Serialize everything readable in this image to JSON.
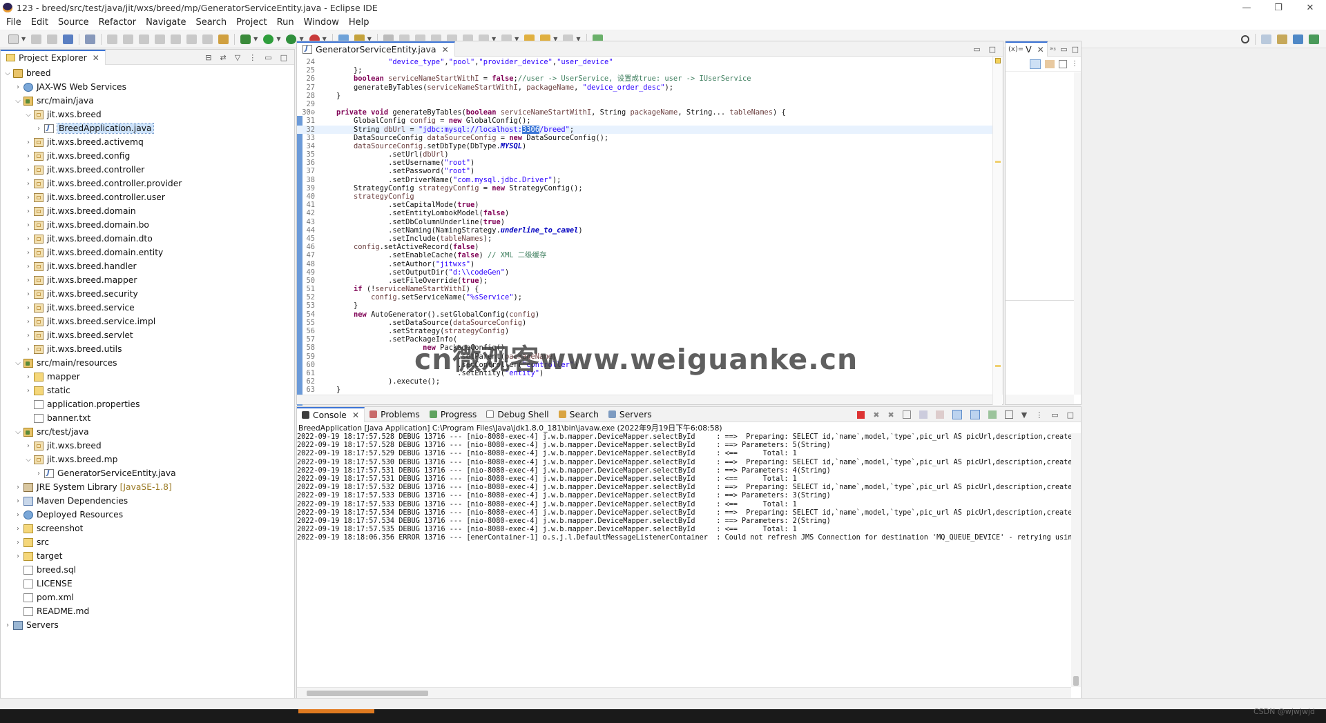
{
  "window": {
    "title": "123 - breed/src/test/java/jit/wxs/breed/mp/GeneratorServiceEntity.java - Eclipse IDE",
    "controls": [
      "—",
      "❐",
      "✕"
    ]
  },
  "menu": [
    "File",
    "Edit",
    "Source",
    "Refactor",
    "Navigate",
    "Search",
    "Project",
    "Run",
    "Window",
    "Help"
  ],
  "project_explorer": {
    "title": "Project Explorer",
    "items": [
      {
        "label": "breed",
        "level": 0,
        "chev": "⌵",
        "icon": "ic-project"
      },
      {
        "label": "JAX-WS Web Services",
        "level": 1,
        "chev": "›",
        "icon": "ic-globe"
      },
      {
        "label": "src/main/java",
        "level": 1,
        "chev": "⌵",
        "icon": "ic-srcfolder"
      },
      {
        "label": "jit.wxs.breed",
        "level": 2,
        "chev": "⌵",
        "icon": "ic-package"
      },
      {
        "label": "BreedApplication.java",
        "level": 3,
        "chev": "›",
        "icon": "ic-java",
        "selected": true
      },
      {
        "label": "jit.wxs.breed.activemq",
        "level": 2,
        "chev": "›",
        "icon": "ic-package"
      },
      {
        "label": "jit.wxs.breed.config",
        "level": 2,
        "chev": "›",
        "icon": "ic-package"
      },
      {
        "label": "jit.wxs.breed.controller",
        "level": 2,
        "chev": "›",
        "icon": "ic-package"
      },
      {
        "label": "jit.wxs.breed.controller.provider",
        "level": 2,
        "chev": "›",
        "icon": "ic-package"
      },
      {
        "label": "jit.wxs.breed.controller.user",
        "level": 2,
        "chev": "›",
        "icon": "ic-package"
      },
      {
        "label": "jit.wxs.breed.domain",
        "level": 2,
        "chev": "›",
        "icon": "ic-package"
      },
      {
        "label": "jit.wxs.breed.domain.bo",
        "level": 2,
        "chev": "›",
        "icon": "ic-package"
      },
      {
        "label": "jit.wxs.breed.domain.dto",
        "level": 2,
        "chev": "›",
        "icon": "ic-package"
      },
      {
        "label": "jit.wxs.breed.domain.entity",
        "level": 2,
        "chev": "›",
        "icon": "ic-package"
      },
      {
        "label": "jit.wxs.breed.handler",
        "level": 2,
        "chev": "›",
        "icon": "ic-package"
      },
      {
        "label": "jit.wxs.breed.mapper",
        "level": 2,
        "chev": "›",
        "icon": "ic-package"
      },
      {
        "label": "jit.wxs.breed.security",
        "level": 2,
        "chev": "›",
        "icon": "ic-package"
      },
      {
        "label": "jit.wxs.breed.service",
        "level": 2,
        "chev": "›",
        "icon": "ic-package"
      },
      {
        "label": "jit.wxs.breed.service.impl",
        "level": 2,
        "chev": "›",
        "icon": "ic-package"
      },
      {
        "label": "jit.wxs.breed.servlet",
        "level": 2,
        "chev": "›",
        "icon": "ic-package"
      },
      {
        "label": "jit.wxs.breed.utils",
        "level": 2,
        "chev": "›",
        "icon": "ic-package"
      },
      {
        "label": "src/main/resources",
        "level": 1,
        "chev": "⌵",
        "icon": "ic-srcfolder"
      },
      {
        "label": "mapper",
        "level": 2,
        "chev": "›",
        "icon": "ic-folder"
      },
      {
        "label": "static",
        "level": 2,
        "chev": "›",
        "icon": "ic-folder"
      },
      {
        "label": "application.properties",
        "level": 2,
        "chev": "",
        "icon": "ic-file"
      },
      {
        "label": "banner.txt",
        "level": 2,
        "chev": "",
        "icon": "ic-file"
      },
      {
        "label": "src/test/java",
        "level": 1,
        "chev": "⌵",
        "icon": "ic-srcfolder"
      },
      {
        "label": "jit.wxs.breed",
        "level": 2,
        "chev": "›",
        "icon": "ic-package"
      },
      {
        "label": "jit.wxs.breed.mp",
        "level": 2,
        "chev": "⌵",
        "icon": "ic-package"
      },
      {
        "label": "GeneratorServiceEntity.java",
        "level": 3,
        "chev": "›",
        "icon": "ic-java"
      },
      {
        "label": "JRE System Library",
        "suffix": "[JavaSE-1.8]",
        "level": 1,
        "chev": "›",
        "icon": "ic-lib"
      },
      {
        "label": "Maven Dependencies",
        "level": 1,
        "chev": "›",
        "icon": "ic-jar"
      },
      {
        "label": "Deployed Resources",
        "level": 1,
        "chev": "›",
        "icon": "ic-globe"
      },
      {
        "label": "screenshot",
        "level": 1,
        "chev": "›",
        "icon": "ic-folder"
      },
      {
        "label": "src",
        "level": 1,
        "chev": "›",
        "icon": "ic-folder"
      },
      {
        "label": "target",
        "level": 1,
        "chev": "›",
        "icon": "ic-folder"
      },
      {
        "label": "breed.sql",
        "level": 1,
        "chev": "",
        "icon": "ic-file"
      },
      {
        "label": "LICENSE",
        "level": 1,
        "chev": "",
        "icon": "ic-file"
      },
      {
        "label": "pom.xml",
        "level": 1,
        "chev": "",
        "icon": "ic-file"
      },
      {
        "label": "README.md",
        "level": 1,
        "chev": "",
        "icon": "ic-file"
      },
      {
        "label": "Servers",
        "level": 0,
        "chev": "›",
        "icon": "ic-server"
      }
    ]
  },
  "editor": {
    "tab_label": "GeneratorServiceEntity.java",
    "current_line": 32,
    "lines": [
      {
        "n": "24",
        "html": "                <span class=\"str\">\"device_type\"</span>,<span class=\"str\">\"pool\"</span>,<span class=\"str\">\"provider_device\"</span>,<span class=\"str\">\"user_device\"</span>"
      },
      {
        "n": "25",
        "html": "        };"
      },
      {
        "n": "26",
        "html": "        <span class=\"kw\">boolean</span> <span class=\"var\">serviceNameStartWithI</span> = <span class=\"kw\">false</span>;<span class=\"cmt\">//user -> UserService, 设置成true: user -> IUserService</span>"
      },
      {
        "n": "27",
        "html": "        generateByTables(<span class=\"var\">serviceNameStartWithI</span>, <span class=\"var\">packageName</span>, <span class=\"str\">\"device_order_desc\"</span>);"
      },
      {
        "n": "28",
        "html": "    }"
      },
      {
        "n": "29",
        "html": ""
      },
      {
        "n": "30⊖",
        "html": "    <span class=\"kw\">private</span> <span class=\"kw\">void</span> generateByTables(<span class=\"kw\">boolean</span> <span class=\"var\">serviceNameStartWithI</span>, String <span class=\"var\">packageName</span>, String... <span class=\"var\">tableNames</span>) {"
      },
      {
        "n": "31",
        "html": "        GlobalConfig <span class=\"var\">config</span> = <span class=\"kw\">new</span> GlobalConfig();"
      },
      {
        "n": "32",
        "html": "        String <span class=\"var\">dbUrl</span> = <span class=\"str\">\"jdbc:mysql://localhost:<span class=\"hl\">3306</span>/breed\"</span>;"
      },
      {
        "n": "33",
        "html": "        DataSourceConfig <span class=\"var\">dataSourceConfig</span> = <span class=\"kw\">new</span> DataSourceConfig();"
      },
      {
        "n": "34",
        "html": "        <span class=\"var\">dataSourceConfig</span>.setDbType(DbType.<span class=\"stf\">MYSQL</span>)"
      },
      {
        "n": "35",
        "html": "                .setUrl(<span class=\"var\">dbUrl</span>)"
      },
      {
        "n": "36",
        "html": "                .setUsername(<span class=\"str\">\"root\"</span>)"
      },
      {
        "n": "37",
        "html": "                .setPassword(<span class=\"str\">\"root\"</span>)"
      },
      {
        "n": "38",
        "html": "                .setDriverName(<span class=\"str\">\"com.mysql.jdbc.Driver\"</span>);"
      },
      {
        "n": "39",
        "html": "        StrategyConfig <span class=\"var\">strategyConfig</span> = <span class=\"kw\">new</span> StrategyConfig();"
      },
      {
        "n": "40",
        "html": "        <span class=\"var\">strategyConfig</span>"
      },
      {
        "n": "41",
        "html": "                .setCapitalMode(<span class=\"kw\">true</span>)"
      },
      {
        "n": "42",
        "html": "                .setEntityLombokModel(<span class=\"kw\">false</span>)"
      },
      {
        "n": "43",
        "html": "                .setDbColumnUnderline(<span class=\"kw\">true</span>)"
      },
      {
        "n": "44",
        "html": "                .setNaming(NamingStrategy.<span class=\"stf\">underline_to_camel</span>)"
      },
      {
        "n": "45",
        "html": "                .setInclude(<span class=\"var\">tableNames</span>);"
      },
      {
        "n": "46",
        "html": "        <span class=\"var\">config</span>.setActiveRecord(<span class=\"kw\">false</span>)"
      },
      {
        "n": "47",
        "html": "                .setEnableCache(<span class=\"kw\">false</span>) <span class=\"cmt\">// XML 二级缓存</span>"
      },
      {
        "n": "48",
        "html": "                .setAuthor(<span class=\"str\">\"jitwxs\"</span>)"
      },
      {
        "n": "49",
        "html": "                .setOutputDir(<span class=\"str\">\"d:\\\\codeGen\"</span>)"
      },
      {
        "n": "50",
        "html": "                .setFileOverride(<span class=\"kw\">true</span>);"
      },
      {
        "n": "51",
        "html": "        <span class=\"kw\">if</span> (!<span class=\"var\">serviceNameStartWithI</span>) {"
      },
      {
        "n": "52",
        "html": "            <span class=\"var\">config</span>.setServiceName(<span class=\"str\">\"%sService\"</span>);"
      },
      {
        "n": "53",
        "html": "        }"
      },
      {
        "n": "54",
        "html": "        <span class=\"kw\">new</span> AutoGenerator().setGlobalConfig(<span class=\"var\">config</span>)"
      },
      {
        "n": "55",
        "html": "                .setDataSource(<span class=\"var\">dataSourceConfig</span>)"
      },
      {
        "n": "56",
        "html": "                .setStrategy(<span class=\"var\">strategyConfig</span>)"
      },
      {
        "n": "57",
        "html": "                .setPackageInfo("
      },
      {
        "n": "58",
        "html": "                        <span class=\"kw\">new</span> PackageConfig()"
      },
      {
        "n": "59",
        "html": "                                .setParent(<span class=\"var\">packageName</span>)"
      },
      {
        "n": "60",
        "html": "                                .setController(<span class=\"str\">\"controller\"</span>)"
      },
      {
        "n": "61",
        "html": "                                .setEntity(<span class=\"str\">\"entity\"</span>)"
      },
      {
        "n": "62",
        "html": "                ).execute();"
      },
      {
        "n": "63",
        "html": "    }"
      },
      {
        "n": "64",
        "html": ""
      }
    ]
  },
  "outline": {
    "tab_label": "V"
  },
  "bottom_panel": {
    "tabs": [
      "Console",
      "Problems",
      "Progress",
      "Debug Shell",
      "Search",
      "Servers"
    ],
    "description": "BreedApplication [Java Application] C:\\Program Files\\Java\\jdk1.8.0_181\\bin\\javaw.exe  (2022年9月19日下午6:08:58)",
    "lines": [
      "2022-09-19 18:17:57.528 DEBUG 13716 --- [nio-8080-exec-4] j.w.b.mapper.DeviceMapper.selectById     : ==>  Preparing: SELECT id,`name`,model,`type`,pic_url AS picUrl,description,create_date AS crea",
      "2022-09-19 18:17:57.528 DEBUG 13716 --- [nio-8080-exec-4] j.w.b.mapper.DeviceMapper.selectById     : ==> Parameters: 5(String)",
      "2022-09-19 18:17:57.529 DEBUG 13716 --- [nio-8080-exec-4] j.w.b.mapper.DeviceMapper.selectById     : <==      Total: 1",
      "2022-09-19 18:17:57.530 DEBUG 13716 --- [nio-8080-exec-4] j.w.b.mapper.DeviceMapper.selectById     : ==>  Preparing: SELECT id,`name`,model,`type`,pic_url AS picUrl,description,create_date AS crea",
      "2022-09-19 18:17:57.531 DEBUG 13716 --- [nio-8080-exec-4] j.w.b.mapper.DeviceMapper.selectById     : ==> Parameters: 4(String)",
      "2022-09-19 18:17:57.531 DEBUG 13716 --- [nio-8080-exec-4] j.w.b.mapper.DeviceMapper.selectById     : <==      Total: 1",
      "2022-09-19 18:17:57.532 DEBUG 13716 --- [nio-8080-exec-4] j.w.b.mapper.DeviceMapper.selectById     : ==>  Preparing: SELECT id,`name`,model,`type`,pic_url AS picUrl,description,create_date AS crea",
      "2022-09-19 18:17:57.533 DEBUG 13716 --- [nio-8080-exec-4] j.w.b.mapper.DeviceMapper.selectById     : ==> Parameters: 3(String)",
      "2022-09-19 18:17:57.533 DEBUG 13716 --- [nio-8080-exec-4] j.w.b.mapper.DeviceMapper.selectById     : <==      Total: 1",
      "2022-09-19 18:17:57.534 DEBUG 13716 --- [nio-8080-exec-4] j.w.b.mapper.DeviceMapper.selectById     : ==>  Preparing: SELECT id,`name`,model,`type`,pic_url AS picUrl,description,create_date AS crea",
      "2022-09-19 18:17:57.534 DEBUG 13716 --- [nio-8080-exec-4] j.w.b.mapper.DeviceMapper.selectById     : ==> Parameters: 2(String)",
      "2022-09-19 18:17:57.535 DEBUG 13716 --- [nio-8080-exec-4] j.w.b.mapper.DeviceMapper.selectById     : <==      Total: 1",
      "2022-09-19 18:18:06.356 ERROR 13716 --- [enerContainer-1] o.s.j.l.DefaultMessageListenerContainer  : Could not refresh JMS Connection for destination 'MQ_QUEUE_DEVICE' - retrying using FixedBackOf"
    ]
  },
  "watermark": "cn微观客www.weiguanke.cn",
  "footer_credit": "CSDN @wjwjwjd"
}
